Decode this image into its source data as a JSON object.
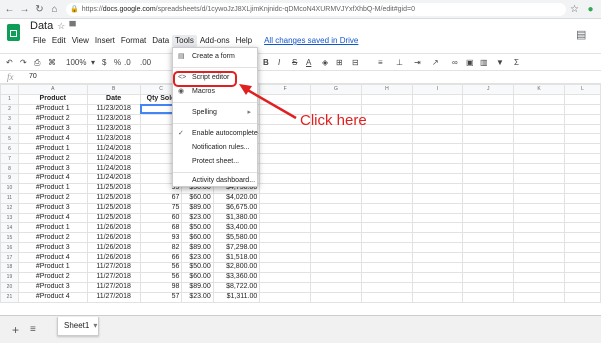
{
  "browser": {
    "back_icon": "arrow-left",
    "forward_icon": "arrow-right",
    "reload_icon": "reload",
    "home_icon": "home",
    "url_scheme": "https://",
    "url_host": "docs.google.com",
    "url_path": "/spreadsheets/d/1cywoJzJ8XLjimKnjnidc-qDMcoN4XURMVJYxfXhbQ-M/edit#gid=0",
    "star_icon": "star"
  },
  "app": {
    "title": "Data",
    "menus": [
      "File",
      "Edit",
      "View",
      "Insert",
      "Format",
      "Data",
      "Tools",
      "Add-ons",
      "Help"
    ],
    "saved_status": "All changes saved in Drive",
    "accent": "#0f9d58"
  },
  "toolbar": {
    "zoom": "100%",
    "currency": "$",
    "percent": "%",
    "decimal_less": ".0",
    "decimal_more": ".00",
    "bold": "B",
    "italic": "I",
    "strike": "S",
    "text_color": "A",
    "functions": "Σ"
  },
  "formula_bar": {
    "fx": "fx",
    "value": "70"
  },
  "columns": [
    "A",
    "B",
    "C",
    "D",
    "E",
    "F",
    "G",
    "H",
    "I",
    "J",
    "K",
    "L"
  ],
  "header_row": [
    "Product",
    "Date",
    "Qty Sold"
  ],
  "rows": [
    [
      "#Product 1",
      "11/23/2018",
      "70",
      "",
      ""
    ],
    [
      "#Product 2",
      "11/23/2018",
      "77",
      "",
      ""
    ],
    [
      "#Product 3",
      "11/23/2018",
      "63",
      "",
      ""
    ],
    [
      "#Product 4",
      "11/23/2018",
      "75",
      "",
      ""
    ],
    [
      "#Product 1",
      "11/24/2018",
      "63",
      "",
      ""
    ],
    [
      "#Product 2",
      "11/24/2018",
      "67",
      "",
      ""
    ],
    [
      "#Product 3",
      "11/24/2018",
      "56",
      "",
      ""
    ],
    [
      "#Product 4",
      "11/24/2018",
      "76",
      "",
      ""
    ],
    [
      "#Product 1",
      "11/25/2018",
      "95",
      "$50.00",
      "$4,750.00"
    ],
    [
      "#Product 2",
      "11/25/2018",
      "67",
      "$60.00",
      "$4,020.00"
    ],
    [
      "#Product 3",
      "11/25/2018",
      "75",
      "$89.00",
      "$6,675.00"
    ],
    [
      "#Product 4",
      "11/25/2018",
      "60",
      "$23.00",
      "$1,380.00"
    ],
    [
      "#Product 1",
      "11/26/2018",
      "68",
      "$50.00",
      "$3,400.00"
    ],
    [
      "#Product 2",
      "11/26/2018",
      "93",
      "$60.00",
      "$5,580.00"
    ],
    [
      "#Product 3",
      "11/26/2018",
      "82",
      "$89.00",
      "$7,298.00"
    ],
    [
      "#Product 4",
      "11/26/2018",
      "66",
      "$23.00",
      "$1,518.00"
    ],
    [
      "#Product 1",
      "11/27/2018",
      "56",
      "$50.00",
      "$2,800.00"
    ],
    [
      "#Product 2",
      "11/27/2018",
      "56",
      "$60.00",
      "$3,360.00"
    ],
    [
      "#Product 3",
      "11/27/2018",
      "98",
      "$89.00",
      "$8,722.00"
    ],
    [
      "#Product 4",
      "11/27/2018",
      "57",
      "$23.00",
      "$1,311.00"
    ]
  ],
  "tools_menu": {
    "items": [
      {
        "label": "Create a form",
        "icon": "form-icon"
      },
      {
        "label": "Script editor",
        "icon": "code-icon"
      },
      {
        "label": "Macros",
        "icon": "macros-icon"
      },
      {
        "label": "Spelling",
        "icon": "",
        "submenu": "▸"
      },
      {
        "label": "Enable autocomplete",
        "icon": "check-icon"
      },
      {
        "label": "Notification rules...",
        "icon": ""
      },
      {
        "label": "Protect sheet...",
        "icon": ""
      },
      {
        "label": "Activity dashboard...",
        "icon": ""
      }
    ]
  },
  "annotation": {
    "text": "Click here",
    "color": "#e02020"
  },
  "sheets": {
    "add_icon": "plus",
    "list_icon": "list",
    "active_tab": "Sheet1"
  }
}
